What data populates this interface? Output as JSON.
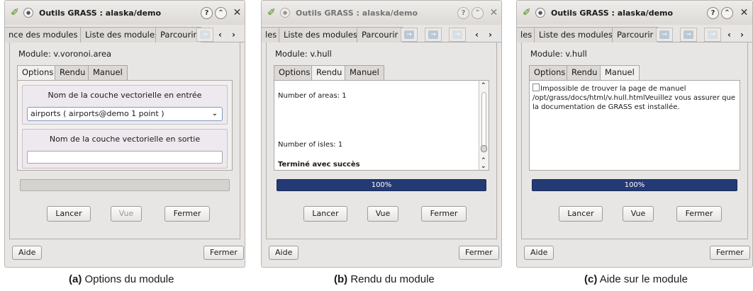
{
  "window_title": "Outils GRASS : alaska/demo",
  "title_icons": {
    "logo": "grass-logo-icon",
    "pin": "pin-icon",
    "help": "?",
    "shade": "⌃",
    "close": "✕"
  },
  "tab_scroll": {
    "left": "‹",
    "right": "›"
  },
  "arrow_glyph": "→",
  "panels": {
    "a": {
      "top_tabs": [
        "nce des modules",
        "Liste des modules",
        "Parcourir"
      ],
      "module_label": "Module: v.voronoi.area",
      "sub_tabs": [
        "Options",
        "Rendu",
        "Manuel"
      ],
      "input_group_title": "Nom de la couche vectorielle en entrée",
      "input_selected": "airports ( airports@demo 1 point )",
      "output_group_title": "Nom de la couche vectorielle en sortie",
      "output_value": "",
      "buttons": {
        "run": "Lancer",
        "view": "Vue",
        "close": "Fermer"
      },
      "bottom": {
        "help": "Aide",
        "close": "Fermer"
      },
      "caption_prefix": "(a)",
      "caption_text": "Options du module"
    },
    "b": {
      "top_tabs": [
        "les",
        "Liste des modules",
        "Parcourir"
      ],
      "module_label": "Module: v.hull",
      "sub_tabs": [
        "Options",
        "Rendu",
        "Manuel"
      ],
      "output_lines": [
        "Number of areas: 1",
        "Number of isles: 1",
        "Terminé avec succès"
      ],
      "progress_value": 100,
      "progress_text": "100%",
      "buttons": {
        "run": "Lancer",
        "view": "Vue",
        "close": "Fermer"
      },
      "bottom": {
        "help": "Aide",
        "close": "Fermer"
      },
      "caption_prefix": "(b)",
      "caption_text": "Rendu du module"
    },
    "c": {
      "top_tabs": [
        "les",
        "Liste des modules",
        "Parcourir"
      ],
      "module_label": "Module: v.hull",
      "sub_tabs": [
        "Options",
        "Rendu",
        "Manuel"
      ],
      "help_text": "Impossible de trouver la page de manuel /opt/grass/docs/html/v.hull.htmlVeuillez vous assurer que la documentation de GRASS est installée.",
      "progress_value": 100,
      "progress_text": "100%",
      "buttons": {
        "run": "Lancer",
        "view": "Vue",
        "close": "Fermer"
      },
      "bottom": {
        "help": "Aide",
        "close": "Fermer"
      },
      "caption_prefix": "(c)",
      "caption_text": "Aide sur le module"
    }
  },
  "colors": {
    "progress_fill": "#243a74",
    "window_bg": "#e8e6e4",
    "grass_green": "#4d8a1a"
  }
}
